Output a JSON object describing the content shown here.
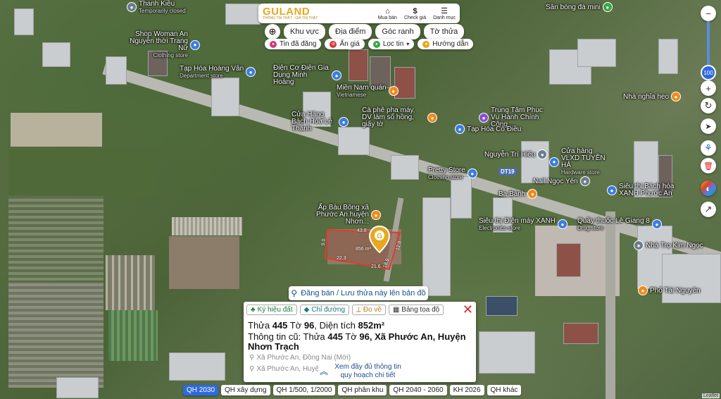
{
  "header": {
    "logo": "GULAND",
    "tagline": "THÔNG TIN THẬT · GIÁ TRỊ THẬT",
    "actions": [
      {
        "label": "Mua bán",
        "icon": "shop-icon"
      },
      {
        "label": "Check giá",
        "icon": "dollar-icon"
      },
      {
        "label": "Danh mục",
        "icon": "menu-icon"
      }
    ]
  },
  "filters": {
    "row1": [
      "Khu vực",
      "Địa điểm",
      "Góc ranh",
      "Tờ thửa"
    ],
    "row2": [
      {
        "label": "Tin đã đăng",
        "color": "#d23b7a"
      },
      {
        "label": "Ẩn giá",
        "color": "#d23b3b"
      },
      {
        "label": "Lọc tin",
        "color": "#39a64a"
      },
      {
        "label": "Hướng dẫn",
        "color": "#e5a81f"
      }
    ]
  },
  "map": {
    "zoom_level": "100",
    "pois": [
      {
        "name": "Thanh Kiều",
        "sub": "Temporarily closed",
        "icon": "grey"
      },
      {
        "name": "Sân bóng đá mini",
        "icon": "green"
      },
      {
        "name": "Shop Woman An Nguyễn thời Trang Nữ",
        "sub": "Clothing store",
        "icon": "blue"
      },
      {
        "name": "Tạp Hóa Hoàng Vân",
        "sub": "Department store",
        "icon": "blue"
      },
      {
        "name": "Điện Cơ Điện Gia Dụng Minh Hoàng",
        "icon": "blue"
      },
      {
        "name": "Miền Nam quán",
        "sub": "Vietnamese",
        "icon": "orange"
      },
      {
        "name": "Cửa Hàng Bách Hóa Lê Thanh",
        "icon": "blue"
      },
      {
        "name": "Cà phê pha máy, DV làm sổ hồng, giấy tờ",
        "icon": "orange"
      },
      {
        "name": "Trung Tâm Phục Vụ Hành Chính Công...",
        "icon": "purple"
      },
      {
        "name": "Tạp Hóa Cô Điều",
        "icon": "blue"
      },
      {
        "name": "Nhà nghỉa heo",
        "icon": "orange"
      },
      {
        "name": "Nguyễn Trí Hiếu",
        "icon": "grey"
      },
      {
        "name": "Cửa hàng VLXD TUYỀN HẢ",
        "sub": "Hardware store",
        "icon": "blue"
      },
      {
        "name": "Pretty Store",
        "sub": "Clothing store",
        "icon": "blue"
      },
      {
        "name": "Nail Ngọc Yến",
        "icon": "grey"
      },
      {
        "name": "Siêu thị Bách hóa XANH Phước An",
        "icon": "blue"
      },
      {
        "name": "Ba Bánh",
        "icon": "orange"
      },
      {
        "name": "Ấp Bàu Bông xã Phước An huyện Nhơn...",
        "icon": "orange"
      },
      {
        "name": "Siêu thị Điện máy XANH",
        "sub": "Electronics store",
        "icon": "blue"
      },
      {
        "name": "Quầy thuốc Lê Giang 8",
        "sub": "Drug store",
        "icon": "blue"
      },
      {
        "name": "Nhà Trọ Kim Ngọc",
        "icon": "grey"
      },
      {
        "name": "Phố Tài Nguyên",
        "icon": "orange"
      }
    ],
    "road_label": "DT19",
    "parcel": {
      "area_label": "856 m²",
      "dims": [
        "43.8",
        "12.8",
        "18.9",
        "22.3",
        "21.6",
        "9.0"
      ]
    }
  },
  "controls": [
    {
      "name": "zoom-out",
      "glyph": "−"
    },
    {
      "name": "zoom-in",
      "glyph": "+"
    },
    {
      "name": "refresh",
      "glyph": "↻"
    },
    {
      "name": "navigate",
      "glyph": "➤"
    },
    {
      "name": "measure",
      "glyph": "⚘"
    },
    {
      "name": "delete",
      "glyph": "🗑"
    }
  ],
  "panel": {
    "save_label": "Đăng bán / Lưu thửa này lên bản đồ",
    "tools": [
      "Ký hiệu đất",
      "Chỉ đường",
      "Đo vẽ",
      "Bảng tọa độ"
    ],
    "line1": {
      "prefix": "Thửa ",
      "lot": "445",
      "mid": " Tờ ",
      "sheet": "96",
      "sep": ", Diện tích ",
      "area": "852m²"
    },
    "line2": {
      "prefix": "Thông tin cũ: Thửa ",
      "lot": "445",
      "mid": " Tờ ",
      "sheet": "96",
      "rest": ", Xã Phước An, Huyện Nhơn Trạch"
    },
    "addr1": "Xã Phước An, Đồng Nai (Mới)",
    "addr2": "Xã Phước An, Huyện",
    "more": "Xem đầy đủ thông tin quy hoạch chi tiết"
  },
  "qh_tabs": [
    "QH 2030",
    "QH xây dựng",
    "QH 1/500, 1/2000",
    "QH phân khu",
    "QH 2040 - 2060",
    "KH 2026",
    "QH khác"
  ],
  "attribution": "Leaflet"
}
